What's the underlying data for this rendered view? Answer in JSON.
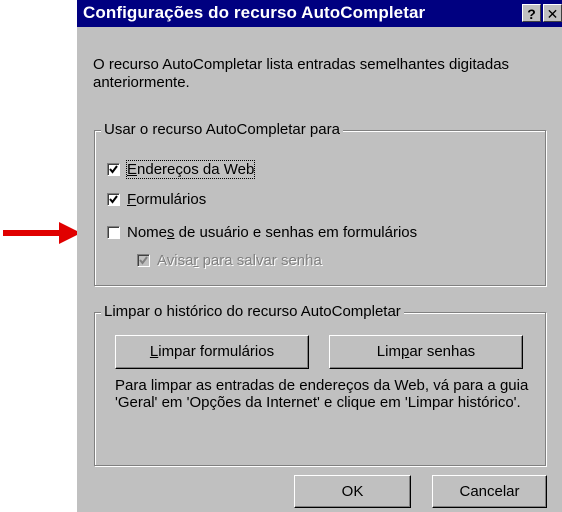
{
  "dialog": {
    "title": "Configurações do recurso AutoCompletar",
    "help_glyph": "?",
    "close_glyph": "✕",
    "description": "O recurso AutoCompletar lista entradas semelhantes digitadas anteriormente."
  },
  "use_group": {
    "legend": "Usar o recurso AutoCompletar para",
    "items": [
      {
        "label_underlined": "E",
        "label_rest": "ndereços da Web",
        "checked": true,
        "enabled": true
      },
      {
        "label_underlined": "F",
        "label_rest": "ormulários",
        "checked": true,
        "enabled": true
      },
      {
        "label_pre": "Nome",
        "label_underlined": "s",
        "label_rest": " de usuário e senhas em formulários",
        "checked": false,
        "enabled": true
      },
      {
        "label_pre": "Avisa",
        "label_underlined": "r",
        "label_rest": " para salvar senha",
        "checked": true,
        "enabled": false
      }
    ]
  },
  "clear_group": {
    "legend": "Limpar o histórico do recurso AutoCompletar",
    "clear_forms_underlined": "L",
    "clear_forms_rest": "impar formulários",
    "clear_passwords_pre": "Lim",
    "clear_passwords_underlined": "p",
    "clear_passwords_rest": "ar senhas",
    "info": "Para limpar as entradas de endereços da Web, vá para a guia 'Geral' em 'Opções da Internet' e clique em 'Limpar histórico'."
  },
  "footer": {
    "ok_label": "OK",
    "cancel_label": "Cancelar"
  },
  "colors": {
    "titlebar": "#000080",
    "face": "#c0c0c0",
    "arrow": "#e00000"
  }
}
